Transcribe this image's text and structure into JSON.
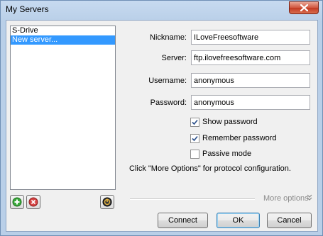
{
  "window": {
    "title": "My Servers"
  },
  "servers": {
    "items": [
      {
        "label": "S-Drive",
        "selected": false
      },
      {
        "label": "New server...",
        "selected": true
      }
    ]
  },
  "list_buttons": {
    "add_icon": "add-icon",
    "remove_icon": "remove-icon",
    "connect_icon": "power-icon"
  },
  "form": {
    "nickname": {
      "label": "Nickname:",
      "value": "ILoveFreesoftware"
    },
    "server": {
      "label": "Server:",
      "value": "ftp.ilovefreesoftware.com"
    },
    "username": {
      "label": "Username:",
      "value": "anonymous"
    },
    "password": {
      "label": "Password:",
      "value": "anonymous"
    },
    "show_password": {
      "label": "Show password",
      "checked": true
    },
    "remember_password": {
      "label": "Remember password",
      "checked": true
    },
    "passive_mode": {
      "label": "Passive mode",
      "checked": false
    },
    "hint": "Click \"More Options\" for protocol configuration."
  },
  "more_options": {
    "label": "More options"
  },
  "buttons": {
    "connect": "Connect",
    "ok": "OK",
    "cancel": "Cancel"
  },
  "colors": {
    "selection": "#3399ff",
    "close": "#c23a22",
    "add": "#2f9a2f",
    "remove": "#d03a3a"
  }
}
